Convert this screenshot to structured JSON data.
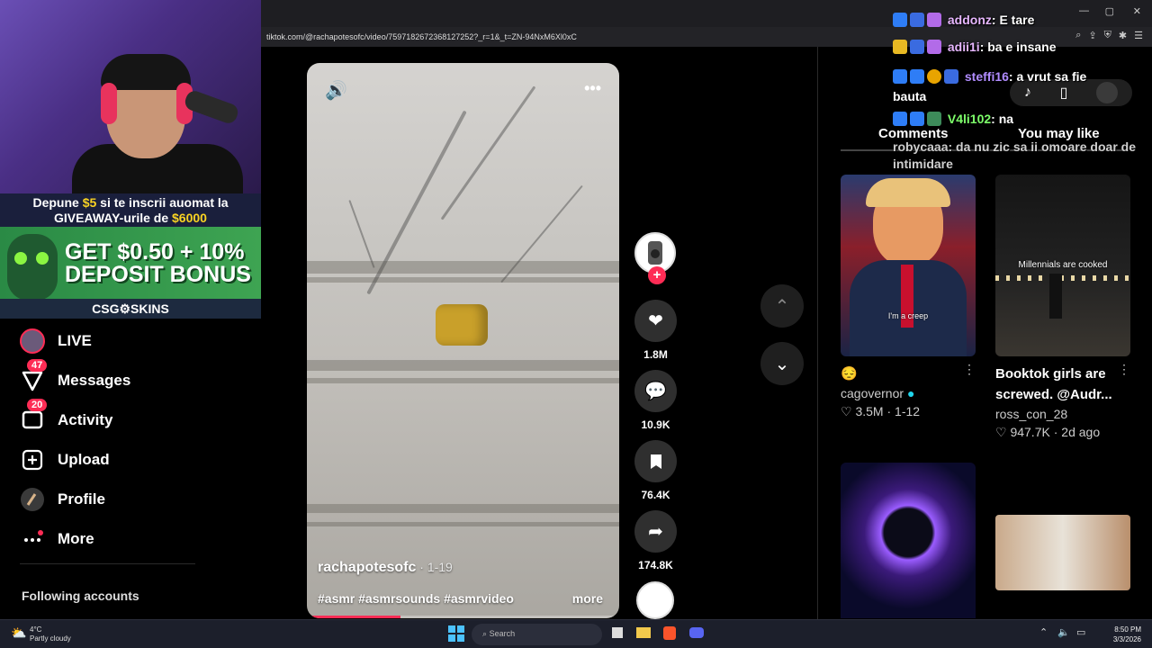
{
  "browser": {
    "url": "tiktok.com/@rachapotesofc/video/7597182672368127252?_r=1&_t=ZN-94NxM6Xl0xC"
  },
  "overlay": {
    "giveaway_line1_a": "Depune ",
    "giveaway_line1_amount": "$5",
    "giveaway_line1_b": " si te inscrii auomat la",
    "giveaway_line2_a": "GIVEAWAY-urile de ",
    "giveaway_line2_amount": "$6000",
    "bonus_line1": "GET $0.50 + 10%",
    "bonus_line2": "DEPOSIT BONUS",
    "brand": "CSG⚙SKINS"
  },
  "sidebar": {
    "items": [
      {
        "label": "LIVE",
        "icon": "live-icon"
      },
      {
        "label": "Messages",
        "icon": "messages-icon",
        "badge": "47"
      },
      {
        "label": "Activity",
        "icon": "activity-icon",
        "badge": "20"
      },
      {
        "label": "Upload",
        "icon": "upload-icon"
      },
      {
        "label": "Profile",
        "icon": "profile-icon"
      },
      {
        "label": "More",
        "icon": "more-icon"
      }
    ],
    "following_header": "Following accounts"
  },
  "video": {
    "author": "rachapotesofc",
    "date": " · 1-19",
    "hashtags": "#asmr #asmrsounds #asmrvideo",
    "more_label": "more",
    "progress": 0.3
  },
  "actions": {
    "likes": "1.8M",
    "comments": "10.9K",
    "saves": "76.4K",
    "shares": "174.8K"
  },
  "right_panel": {
    "tabs": [
      "Comments",
      "You may like"
    ],
    "cards": [
      {
        "title": "😔",
        "user": "cagovernor",
        "verified": true,
        "likes": "3.5M",
        "date": "1-12",
        "overlay": "I'm a creep"
      },
      {
        "title": "Booktok girls are screwed. @Audr...",
        "user": "ross_con_28",
        "likes": "947.7K",
        "date": "2d ago",
        "overlay": "Millennials are cooked"
      }
    ]
  },
  "chat": [
    {
      "user": "addonz",
      "msg": "E tare",
      "color": "#e7b7ff"
    },
    {
      "user": "adii1i",
      "msg": "ba e insane",
      "color": "#e7b7ff"
    },
    {
      "user": "steffi16",
      "msg": "a vrut sa fie bauta",
      "color": "#b18cff"
    },
    {
      "user": "V4li102",
      "msg": "na",
      "color": "#7dff6a"
    },
    {
      "user": "robycaaa",
      "msg": "da nu zic sa ii omoare doar de intimidare",
      "color": "#cccccc"
    }
  ],
  "taskbar": {
    "weather_temp": "4°C",
    "weather_desc": "Partly cloudy",
    "search_placeholder": "Search",
    "time": "8:50 PM",
    "date": "3/3/2026"
  }
}
